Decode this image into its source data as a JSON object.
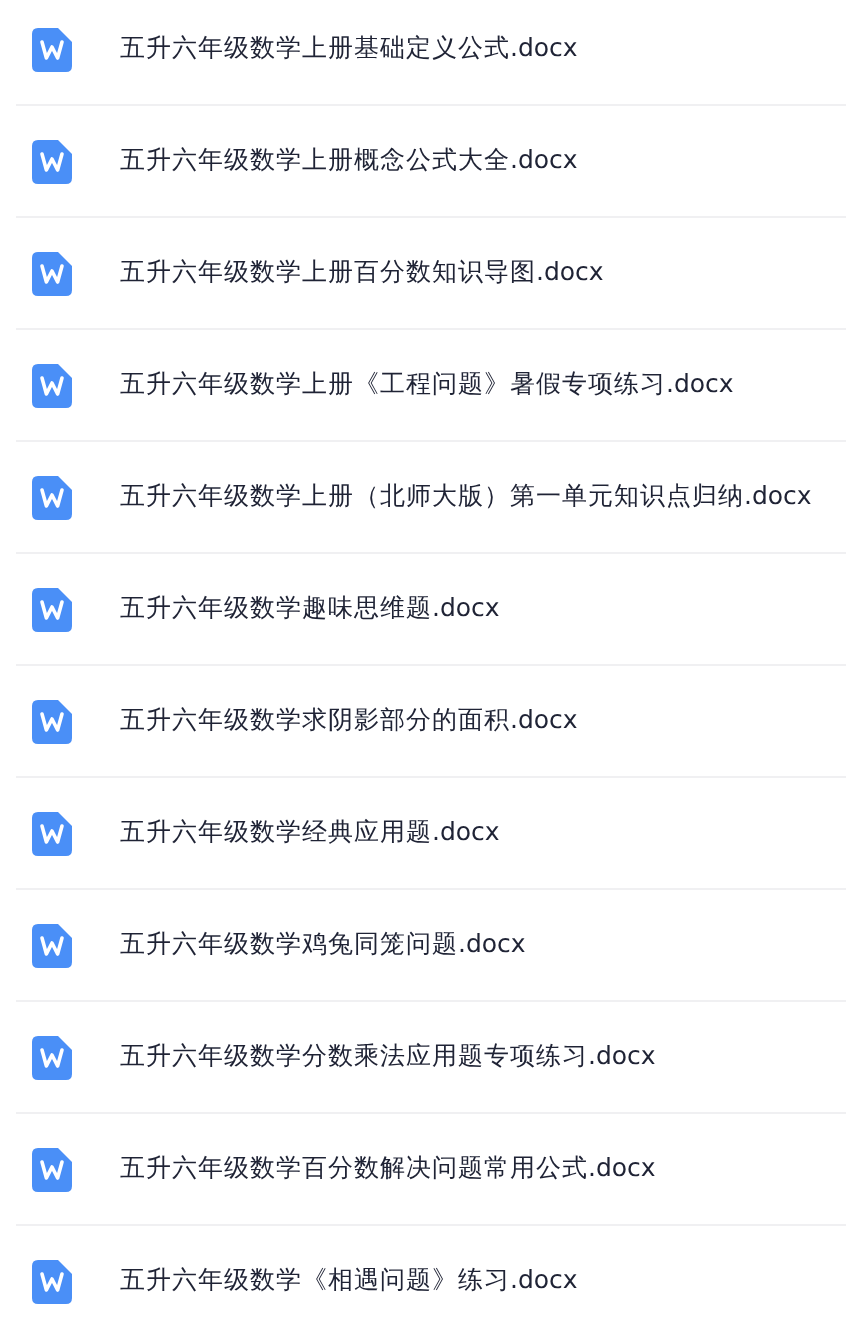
{
  "files": [
    {
      "name": "五升六年级数学上册基础定义公式.docx"
    },
    {
      "name": "五升六年级数学上册概念公式大全.docx"
    },
    {
      "name": "五升六年级数学上册百分数知识导图.docx"
    },
    {
      "name": "五升六年级数学上册《工程问题》暑假专项练习.docx"
    },
    {
      "name": "五升六年级数学上册（北师大版）第一单元知识点归纳.docx"
    },
    {
      "name": "五升六年级数学趣味思维题.docx"
    },
    {
      "name": "五升六年级数学求阴影部分的面积.docx"
    },
    {
      "name": "五升六年级数学经典应用题.docx"
    },
    {
      "name": "五升六年级数学鸡兔同笼问题.docx"
    },
    {
      "name": "五升六年级数学分数乘法应用题专项练习.docx"
    },
    {
      "name": "五升六年级数学百分数解决问题常用公式.docx"
    },
    {
      "name": "五升六年级数学《相遇问题》练习.docx"
    }
  ]
}
